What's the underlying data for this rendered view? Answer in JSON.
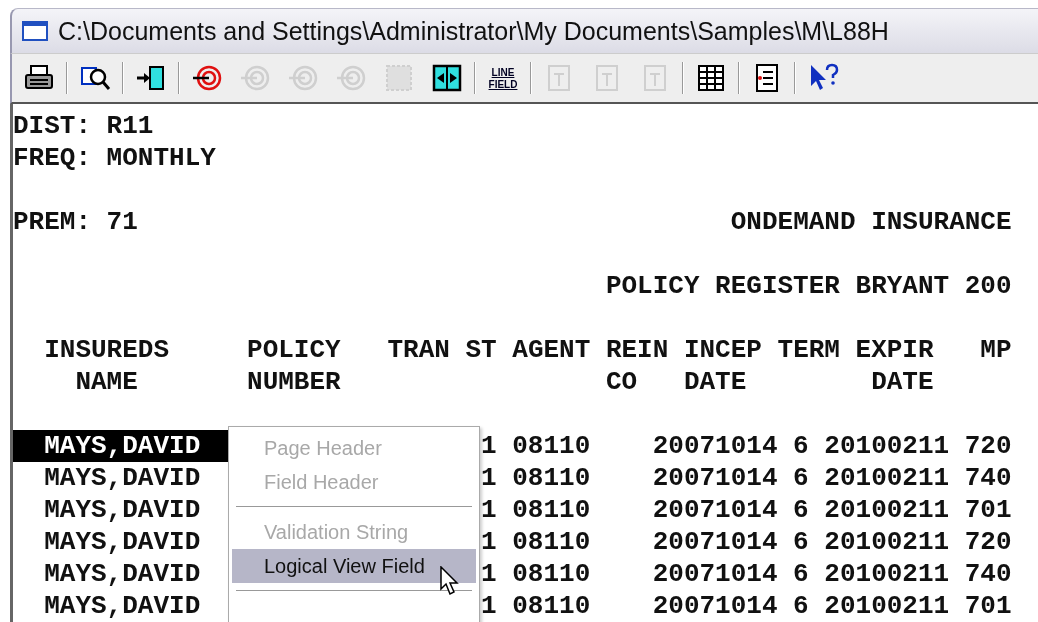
{
  "window": {
    "title": "C:\\Documents and Settings\\Administrator\\My Documents\\Samples\\M\\L88H"
  },
  "toolbar": [
    {
      "kind": "icon",
      "disabled": false
    },
    {
      "kind": "separator"
    },
    {
      "kind": "icon",
      "disabled": false
    },
    {
      "kind": "separator"
    },
    {
      "kind": "icon",
      "disabled": false
    },
    {
      "kind": "separator"
    },
    {
      "kind": "icon",
      "disabled": false
    },
    {
      "kind": "icon",
      "disabled": true
    },
    {
      "kind": "icon",
      "disabled": true
    },
    {
      "kind": "icon",
      "disabled": true
    },
    {
      "kind": "icon",
      "disabled": true
    },
    {
      "kind": "icon",
      "disabled": false
    },
    {
      "kind": "separator"
    },
    {
      "kind": "text",
      "lines": [
        "LINE",
        "FIELD"
      ],
      "disabled": false
    },
    {
      "kind": "separator"
    },
    {
      "kind": "icon",
      "disabled": true
    },
    {
      "kind": "icon",
      "disabled": true
    },
    {
      "kind": "icon",
      "disabled": true
    },
    {
      "kind": "separator"
    },
    {
      "kind": "icon",
      "disabled": false
    },
    {
      "kind": "separator"
    },
    {
      "kind": "icon",
      "disabled": false
    },
    {
      "kind": "separator"
    },
    {
      "kind": "icon",
      "disabled": false
    }
  ],
  "report": {
    "meta_lines": [
      "DIST: R11",
      "FREQ: MONTHLY"
    ],
    "prem_line": {
      "left": "PREM: 71",
      "right": "ONDEMAND INSURANCE"
    },
    "title_line": "POLICY REGISTER BRYANT 200",
    "header_lines": [
      "  INSUREDS     POLICY   TRAN ST AGENT REIN INCEP TERM EXPIR   MP",
      "    NAME       NUMBER                 CO   DATE        DATE"
    ],
    "rows": [
      {
        "name": "MAYS,DAVID",
        "rest": "1 08110    20071014 6 20100211 720",
        "selected": true
      },
      {
        "name": "MAYS,DAVID",
        "rest": "1 08110    20071014 6 20100211 740",
        "selected": false
      },
      {
        "name": "MAYS,DAVID",
        "rest": "1 08110    20071014 6 20100211 701",
        "selected": false
      },
      {
        "name": "MAYS,DAVID",
        "rest": "1 08110    20071014 6 20100211 720",
        "selected": false
      },
      {
        "name": "MAYS,DAVID",
        "rest": "1 08110    20071014 6 20100211 740",
        "selected": false
      },
      {
        "name": "MAYS,DAVID",
        "rest": "1 08110    20071014 6 20100211 701",
        "selected": false
      }
    ]
  },
  "context_menu": {
    "items": [
      {
        "kind": "item",
        "label": "Page Header",
        "disabled": true,
        "selected": false
      },
      {
        "kind": "item",
        "label": "Field Header",
        "disabled": true,
        "selected": false
      },
      {
        "kind": "separator"
      },
      {
        "kind": "item",
        "label": "Validation String",
        "disabled": true,
        "selected": false
      },
      {
        "kind": "item",
        "label": "Logical View Field",
        "disabled": false,
        "selected": true
      },
      {
        "kind": "separator"
      }
    ]
  }
}
